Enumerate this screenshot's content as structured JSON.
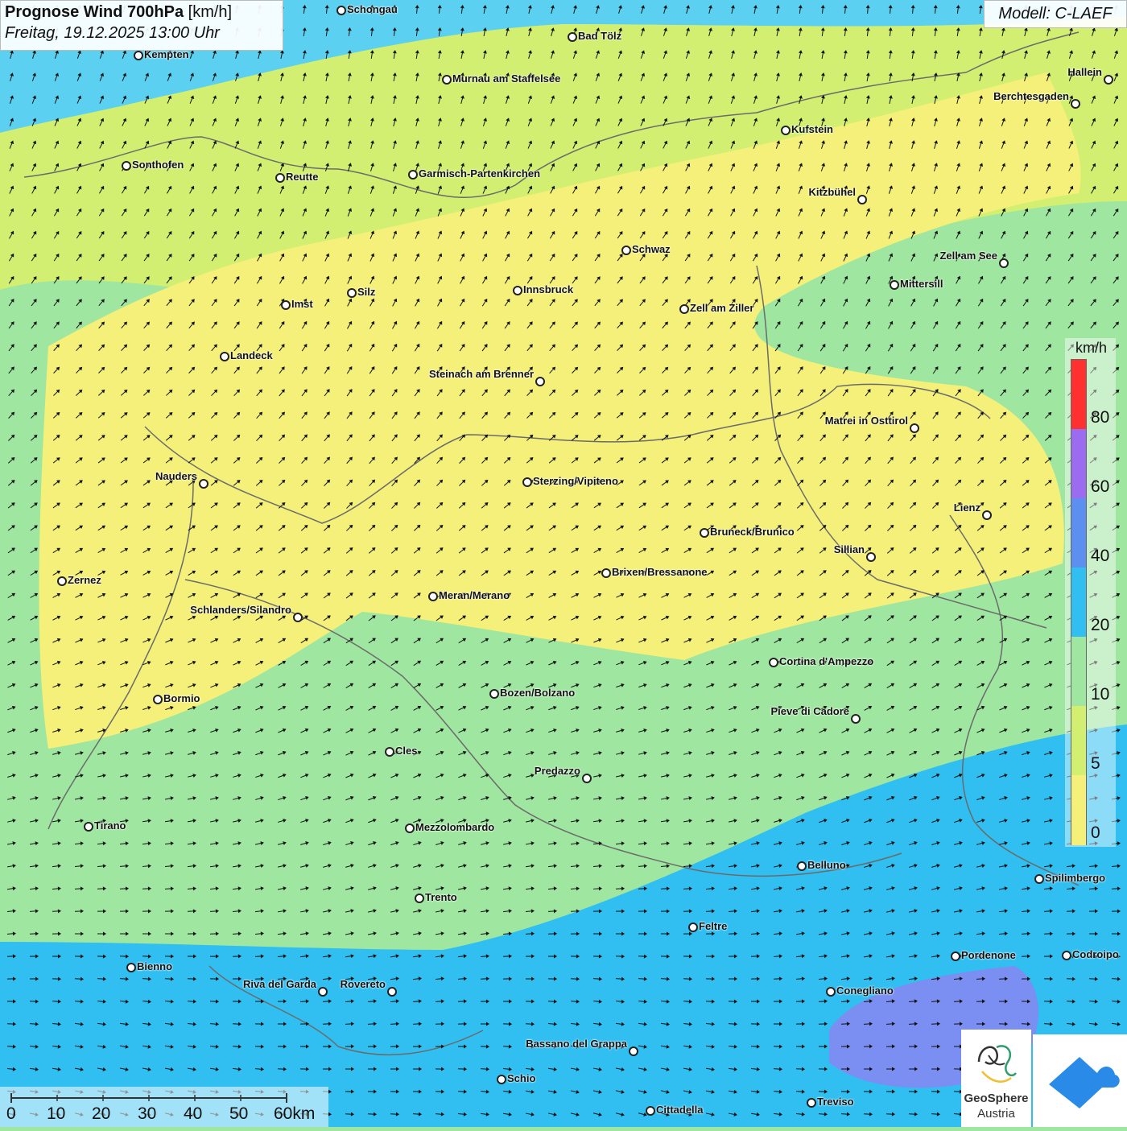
{
  "title": {
    "bold": "Prognose Wind 700hPa",
    "unit": " [km/h]",
    "datetime": "Freitag, 19.12.2025 13:00 Uhr"
  },
  "model": "Modell: C-LAEF",
  "legend": {
    "unit": "km/h",
    "labels": [
      "80",
      "60",
      "40",
      "20",
      "10",
      "5",
      "0"
    ],
    "colors": [
      "#ff3030",
      "#9b6cf0",
      "#5c8ff0",
      "#30bff0",
      "#9fe6a0",
      "#d2ef72",
      "#f4f07a"
    ]
  },
  "scale_bar": {
    "labels": [
      "0",
      "10",
      "20",
      "30",
      "40",
      "50",
      "60km"
    ]
  },
  "logo": {
    "line1": "GeoSphere",
    "line2": "Austria"
  },
  "cities": [
    {
      "name": "Schongau"
    },
    {
      "name": "Bad Tölz"
    },
    {
      "name": "Kempten"
    },
    {
      "name": "Murnau am Staffelsee"
    },
    {
      "name": "Hallein"
    },
    {
      "name": "Berchtesgaden"
    },
    {
      "name": "Kufstein"
    },
    {
      "name": "Sonthofen"
    },
    {
      "name": "Reutte"
    },
    {
      "name": "Garmisch-Partenkirchen"
    },
    {
      "name": "Kitzbühel"
    },
    {
      "name": "Schwaz"
    },
    {
      "name": "Zell am See"
    },
    {
      "name": "Mittersill"
    },
    {
      "name": "Innsbruck"
    },
    {
      "name": "Silz"
    },
    {
      "name": "Imst"
    },
    {
      "name": "Zell am Ziller"
    },
    {
      "name": "Landeck"
    },
    {
      "name": "Steinach am Brenner"
    },
    {
      "name": "Matrei in Osttirol"
    },
    {
      "name": "Nauders"
    },
    {
      "name": "Sterzing/Vipiteno"
    },
    {
      "name": "Lienz"
    },
    {
      "name": "Bruneck/Brunico"
    },
    {
      "name": "Sillian"
    },
    {
      "name": "Brixen/Bressanone"
    },
    {
      "name": "Zernez"
    },
    {
      "name": "Meran/Merano"
    },
    {
      "name": "Schlanders/Silandro"
    },
    {
      "name": "Cortina d'Ampezzo"
    },
    {
      "name": "Bozen/Bolzano"
    },
    {
      "name": "Bormio"
    },
    {
      "name": "Pieve di Cadore"
    },
    {
      "name": "Cles"
    },
    {
      "name": "Predazzo"
    },
    {
      "name": "Tirano"
    },
    {
      "name": "Mezzolombardo"
    },
    {
      "name": "Belluno"
    },
    {
      "name": "Spilimbergo"
    },
    {
      "name": "Trento"
    },
    {
      "name": "Feltre"
    },
    {
      "name": "Bienno"
    },
    {
      "name": "Pordenone"
    },
    {
      "name": "Codroipo"
    },
    {
      "name": "Riva del Garda"
    },
    {
      "name": "Rovereto"
    },
    {
      "name": "Conegliano"
    },
    {
      "name": "Bassano del Grappa"
    },
    {
      "name": "Schio"
    },
    {
      "name": "Treviso"
    },
    {
      "name": "Cittadella"
    }
  ]
}
